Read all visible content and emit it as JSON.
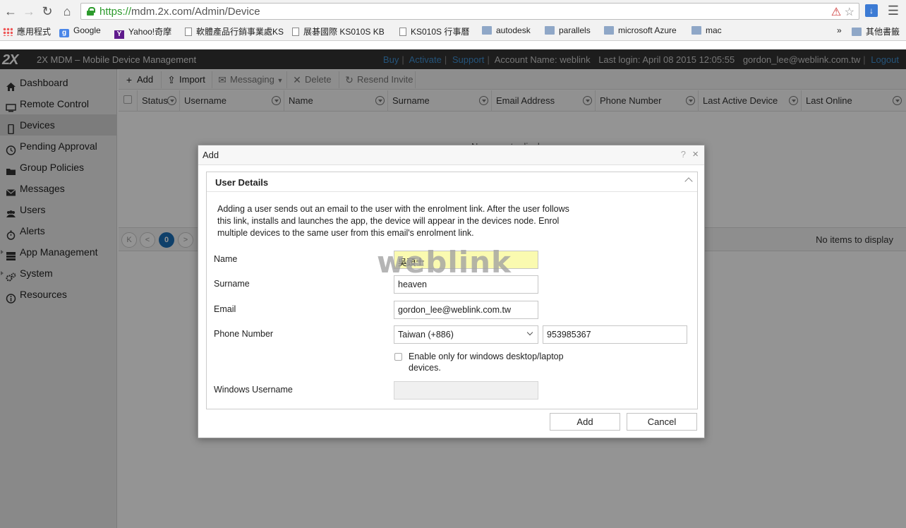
{
  "browser": {
    "url_scheme": "https://",
    "url_rest": "mdm.2x.com/Admin/Device",
    "bookmarks": [
      "應用程式",
      "Google",
      "Yahoo!奇摩",
      "軟體產品行銷事業處KS",
      "展碁國際 KS010S KB",
      "KS010S 行事曆",
      "autodesk",
      "parallels",
      "microsoft Azure",
      "mac"
    ],
    "bookmarks_overflow": "»",
    "other_bookmarks": "其他書籤"
  },
  "header": {
    "logo_text": "2X",
    "product_name": "2X MDM – Mobile Device Management",
    "links": [
      "Buy",
      "Activate",
      "Support"
    ],
    "account_label": "Account Name: weblink",
    "last_login": "Last login: April 08 2015 12:05:55",
    "user_email": "gordon_lee@weblink.com.tw",
    "logout": "Logout",
    "link_color": "#3f8fd1"
  },
  "sidebar": {
    "items": [
      {
        "label": "Dashboard",
        "icon": "home-icon"
      },
      {
        "label": "Remote Control",
        "icon": "monitor-icon"
      },
      {
        "label": "Devices",
        "icon": "phone-icon",
        "active": true
      },
      {
        "label": "Pending Approval",
        "icon": "clock-icon"
      },
      {
        "label": "Group Policies",
        "icon": "folder-icon"
      },
      {
        "label": "Messages",
        "icon": "envelope-icon"
      },
      {
        "label": "Users",
        "icon": "users-icon"
      },
      {
        "label": "Alerts",
        "icon": "stopwatch-icon"
      },
      {
        "label": "App Management",
        "icon": "apps-icon"
      },
      {
        "label": "System",
        "icon": "gears-icon"
      },
      {
        "label": "Resources",
        "icon": "info-icon"
      }
    ]
  },
  "toolbar": {
    "add": "Add",
    "import": "Import",
    "messaging": "Messaging",
    "delete": "Delete",
    "resend": "Resend Invite"
  },
  "grid": {
    "columns": [
      "Status",
      "Username",
      "Name",
      "Surname",
      "Email Address",
      "Phone Number",
      "Last Active Device",
      "Last Online"
    ],
    "empty_text": "No users to display",
    "pager_info": "No items to display",
    "current_page": "0"
  },
  "dialog": {
    "title": "Add",
    "help": "?",
    "close": "×",
    "panel_title": "User Details",
    "description": "Adding a user sends out an email to the user with the enrolment link. After the user follows this link, installs and launches the app, the device will appear in the devices node. Enrol multiple devices to the same user from this email's enrolment link.",
    "fields": {
      "name_label": "Name",
      "name_value": "吳頭士",
      "surname_label": "Surname",
      "surname_value": "heaven",
      "email_label": "Email",
      "email_value": "gordon_lee@weblink.com.tw",
      "phone_label": "Phone Number",
      "country_value": "Taiwan (+886)",
      "phone_value": "953985367",
      "windows_only_label": "Enable only for windows desktop/laptop devices.",
      "windows_username_label": "Windows Username",
      "windows_username_value": ""
    },
    "add_button": "Add",
    "cancel_button": "Cancel"
  },
  "watermark": "weblink",
  "colors": {
    "highlight_input": "#fafab0",
    "pager_current": "#1b6fb7",
    "url_green": "#2c9a2c"
  }
}
